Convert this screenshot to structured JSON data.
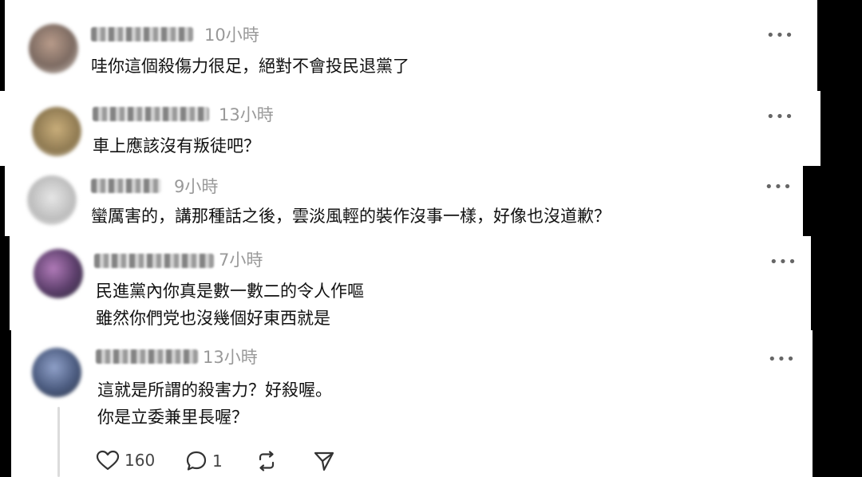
{
  "comments": [
    {
      "time": "10小時",
      "lines": [
        "哇你這個殺傷力很足，絕對不會投民退黨了"
      ]
    },
    {
      "time": "13小時",
      "lines": [
        "車上應該沒有叛徒吧？"
      ]
    },
    {
      "time": "9小時",
      "lines": [
        "蠻厲害的，講那種話之後，雲淡風輕的裝作沒事一樣，好像也沒道歉？"
      ]
    },
    {
      "time": "7小時",
      "lines": [
        "民進黨內你真是數一數二的令人作嘔",
        "雖然你們党也沒幾個好東西就是"
      ]
    },
    {
      "time": "13小時",
      "lines": [
        "這就是所謂的殺害力？好殺喔。",
        "你是立委兼里長喔？"
      ]
    }
  ],
  "more_label": "•••",
  "actions": {
    "likes": "160",
    "replies": "1"
  },
  "icons": [
    "heart-icon",
    "comment-icon",
    "repost-icon",
    "share-icon",
    "more-icon"
  ],
  "colors": {
    "background": "#000000",
    "panel": "#ffffff",
    "muted": "#999999",
    "text": "#111111"
  }
}
